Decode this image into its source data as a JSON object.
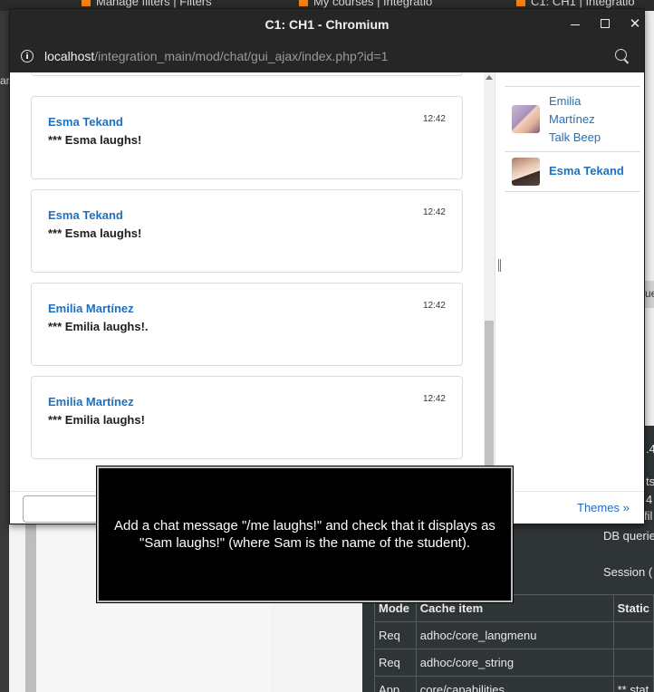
{
  "host_tabs": [
    {
      "label": "Manage filters | Filters"
    },
    {
      "label": "My courses | Integratio"
    },
    {
      "label": "C1: CH1 | Integratio"
    }
  ],
  "window": {
    "title": "C1: CH1 - Chromium"
  },
  "address_bar": {
    "host": "localhost",
    "path": "/integration_main/mod/chat/gui_ajax/index.php?id=1"
  },
  "messages": [
    {
      "author": "Esma Tekand",
      "time": "12:42",
      "text": "*** Esma laughs!"
    },
    {
      "author": "Esma Tekand",
      "time": "12:42",
      "text": "*** Esma laughs!"
    },
    {
      "author": "Emilia Martínez",
      "time": "12:42",
      "text": "*** Emilia laughs!."
    },
    {
      "author": "Emilia Martínez",
      "time": "12:42",
      "text": "*** Emilia laughs!"
    }
  ],
  "users": [
    {
      "name_line1": "Emilia",
      "name_line2": "Martínez",
      "name_line3": "Talk Beep",
      "avatar_icon": "user-avatar-icon"
    },
    {
      "name": "Esma Tekand",
      "avatar_icon": "user-avatar-icon"
    }
  ],
  "bottom": {
    "themes_link": "Themes »"
  },
  "instruction": {
    "text": "Add a chat message \"/me laughs!\" and check that it displays as \"Sam laughs!\" (where Sam is the name of the student)."
  },
  "background_page": {
    "left_letters": "ar",
    "right_edge_text": "ue",
    "side_snippets": {
      "a": ".4",
      "b": "ts",
      "c": "4",
      "d": "fil"
    },
    "db_queries_label": "DB querie",
    "session_label": "Session (",
    "table_headers": {
      "mode": "Mode",
      "cache_item": "Cache item",
      "static": "Static"
    },
    "table_rows": [
      {
        "mode": "Req",
        "item": "adhoc/core_langmenu",
        "static": ""
      },
      {
        "mode": "Req",
        "item": "adhoc/core_string",
        "static": ""
      },
      {
        "mode": "App",
        "item": "core/capabilities",
        "static": "** stat"
      }
    ]
  }
}
